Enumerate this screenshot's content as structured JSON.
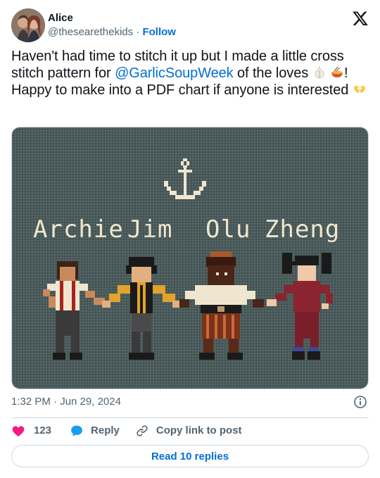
{
  "author": {
    "display_name": "Alice",
    "handle": "@thesearethekids",
    "separator": "·",
    "follow_label": "Follow"
  },
  "tweet": {
    "text_part1": "Haven't had time to stitch it up but I made a little cross stitch pattern for ",
    "mention": "@GarlicSoupWeek",
    "text_part2": " of the loves ",
    "text_part3": "! Happy to make into a PDF chart if anyone is interested "
  },
  "media": {
    "names": [
      "Archie",
      "Jim",
      "Olu",
      "Zheng"
    ],
    "colors": {
      "fabric": "#4a5a5a",
      "thread": "#efe6cf"
    }
  },
  "meta": {
    "timestamp": "1:32 PM · Jun 29, 2024"
  },
  "actions": {
    "like_count": "123",
    "reply_label": "Reply",
    "copy_label": "Copy link to post"
  },
  "footer": {
    "read_replies_label": "Read 10 replies"
  },
  "colors": {
    "link": "#006fd6",
    "secondary_text": "#536471",
    "like": "#f91880",
    "border": "#cfd9de"
  },
  "icons": [
    "x-logo-icon",
    "info-icon",
    "heart-icon",
    "reply-bubble-icon",
    "link-icon",
    "garlic-emoji-icon",
    "soup-bowl-emoji-icon",
    "heart-hands-emoji-icon"
  ]
}
